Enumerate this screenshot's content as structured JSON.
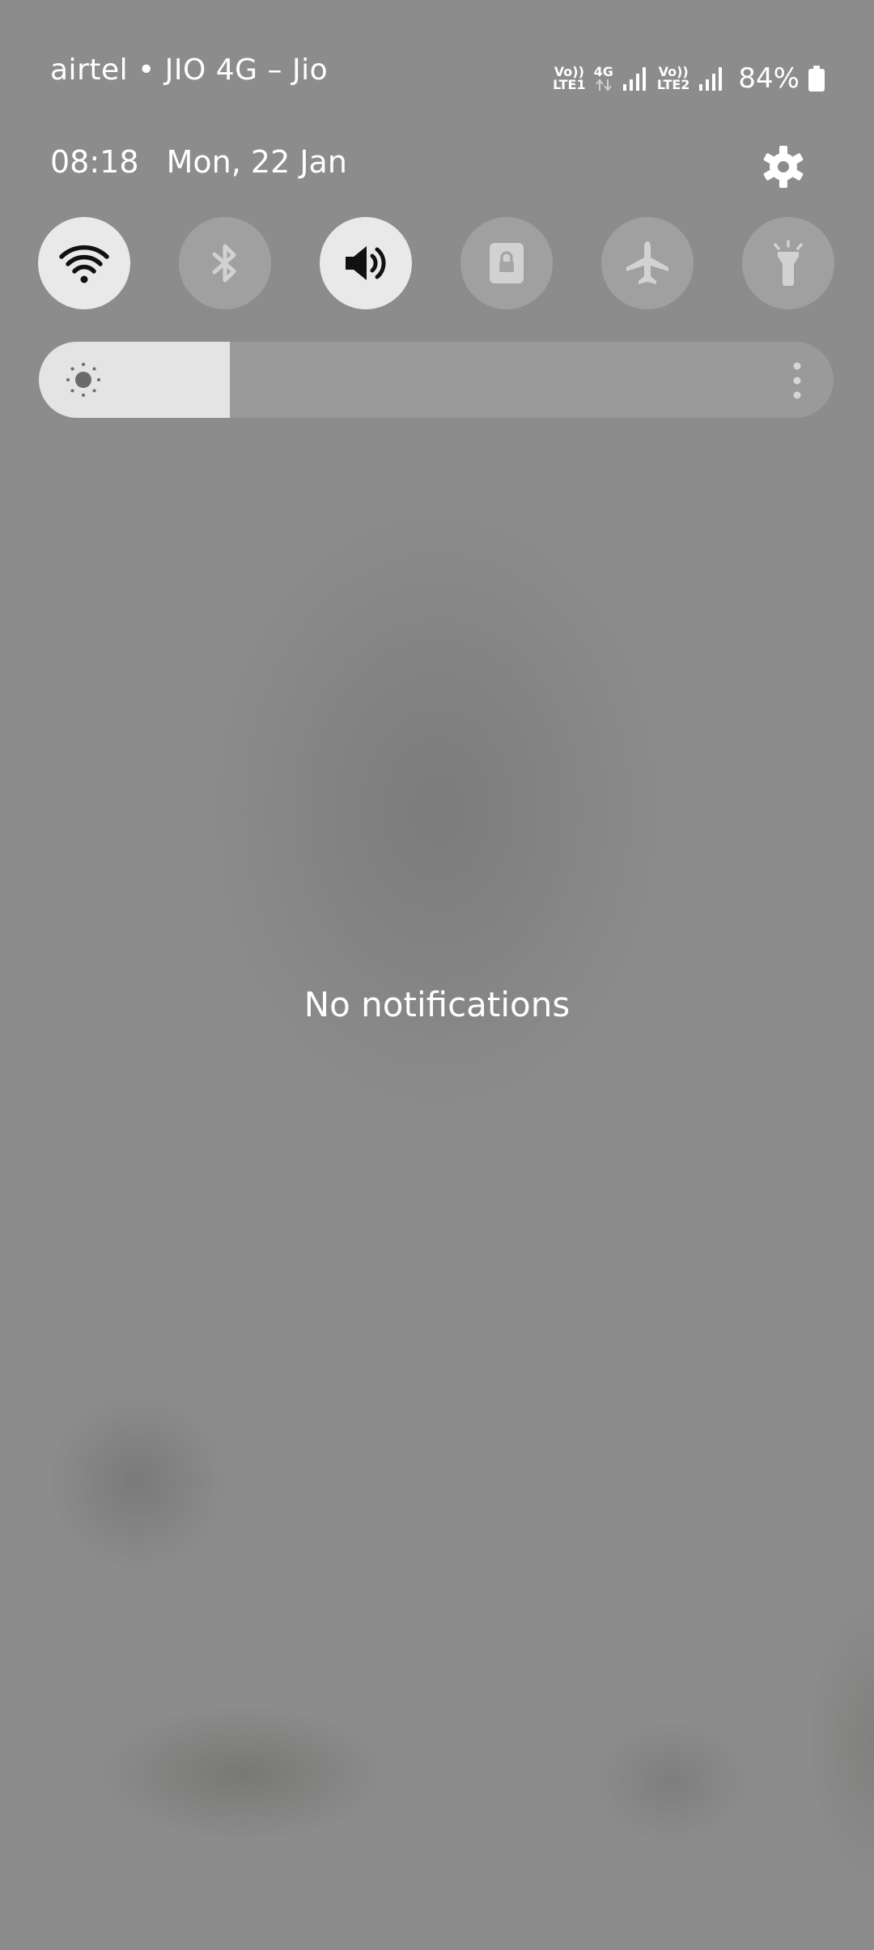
{
  "status_bar": {
    "carrier": "airtel • JIO 4G – Jio",
    "sim1": {
      "volte": "Vo))",
      "tech": "LTE1"
    },
    "data": {
      "type": "4G"
    },
    "sim2": {
      "volte": "Vo))",
      "tech": "LTE2"
    },
    "battery_percent": "84%"
  },
  "header": {
    "time": "08:18",
    "date": "Mon, 22 Jan",
    "settings_icon": "gear-icon"
  },
  "quick_tiles": [
    {
      "name": "wifi",
      "icon": "wifi-icon",
      "state": "on"
    },
    {
      "name": "bluetooth",
      "icon": "bluetooth-icon",
      "state": "off"
    },
    {
      "name": "sound",
      "icon": "speaker-icon",
      "state": "on"
    },
    {
      "name": "rotation-lock",
      "icon": "portrait-lock-icon",
      "state": "off"
    },
    {
      "name": "airplane-mode",
      "icon": "airplane-icon",
      "state": "off"
    },
    {
      "name": "flashlight",
      "icon": "flashlight-icon",
      "state": "off"
    }
  ],
  "brightness": {
    "level": 0.24,
    "icon": "sun-icon",
    "more_icon": "more-vertical-icon"
  },
  "notifications": {
    "empty_text": "No notifications"
  },
  "colors": {
    "background": "#8c8c8c",
    "tile_on": "#e9e9e9",
    "icon_on": "#111111",
    "text": "#ffffff"
  }
}
